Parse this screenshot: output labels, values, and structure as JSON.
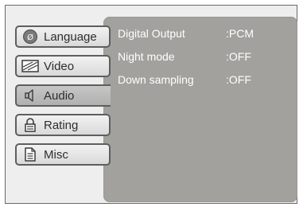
{
  "menu": {
    "tabs": [
      {
        "label": "Language",
        "icon": "language-icon"
      },
      {
        "label": "Video",
        "icon": "video-icon"
      },
      {
        "label": "Audio",
        "icon": "speaker-icon",
        "active": true
      },
      {
        "label": "Rating",
        "icon": "lock-icon"
      },
      {
        "label": "Misc",
        "icon": "document-icon"
      }
    ]
  },
  "settings": [
    {
      "name": "Digital Output",
      "value": ":PCM"
    },
    {
      "name": "Night mode",
      "value": ":OFF"
    },
    {
      "name": "Down sampling",
      "value": ":OFF"
    }
  ],
  "colors": {
    "panel": "#a3a19d",
    "active_tab": "#bcbcbc",
    "tab": "#e6e6e6",
    "border": "#5e5e5e"
  }
}
